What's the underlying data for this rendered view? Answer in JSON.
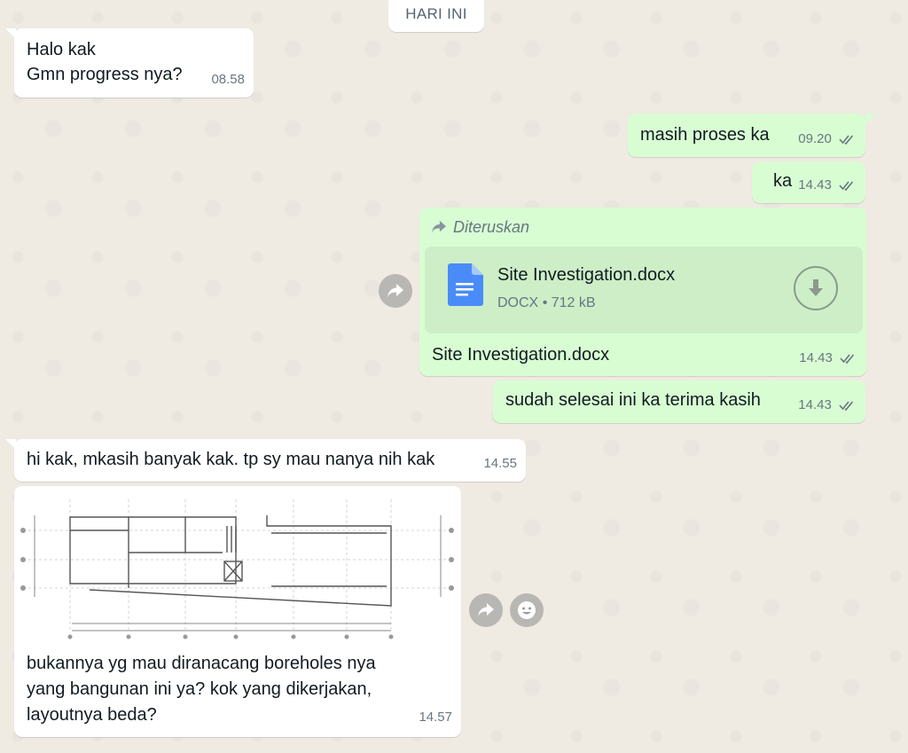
{
  "day_divider": "HARI INI",
  "messages": {
    "m1": {
      "line1": "Halo kak",
      "line2": "Gmn progress nya?",
      "time": "08.58"
    },
    "m2": {
      "text": "masih proses ka",
      "time": "09.20"
    },
    "m3": {
      "text": "ka",
      "time": "14.43"
    },
    "m4": {
      "forwarded_label": "Diteruskan",
      "file_name": "Site Investigation.docx",
      "file_type": "DOCX",
      "file_size": "712 kB",
      "caption": "Site Investigation.docx",
      "time": "14.43"
    },
    "m5": {
      "text": "sudah selesai ini ka terima kasih",
      "time": "14.43"
    },
    "m6": {
      "text": "hi kak, mkasih banyak kak. tp sy mau nanya nih kak",
      "time": "14.55"
    },
    "m7": {
      "line1": "bukannya yg mau diranacang boreholes nya",
      "line2": "yang bangunan ini ya? kok yang dikerjakan,",
      "line3": "layoutnya beda?",
      "time": "14.57"
    }
  },
  "icons": {
    "forward": "forward-arrow-icon",
    "document": "docx-file-icon",
    "download": "download-icon",
    "emoji": "emoji-reaction-icon",
    "read_receipt": "double-check-icon"
  },
  "colors": {
    "incoming": "#ffffff",
    "outgoing": "#d9fdd3",
    "doc_blue": "#4a8cf7",
    "read_tick": "#667781"
  }
}
